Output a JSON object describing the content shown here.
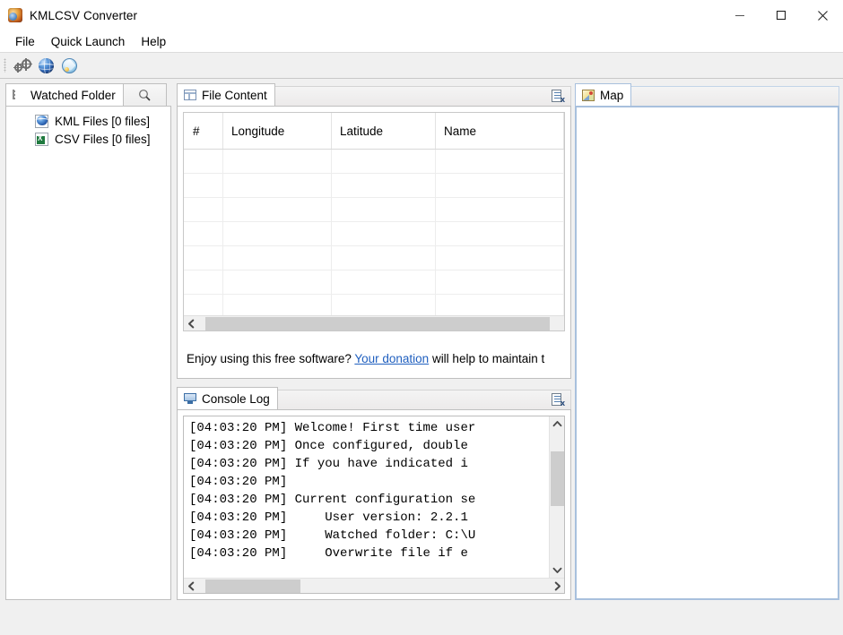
{
  "window": {
    "title": "KMLCSV Converter",
    "app_icon": "app-globe-icon",
    "minimize_label": "─",
    "maximize_label": "□",
    "close_label": "✕"
  },
  "menubar": {
    "items": [
      {
        "label": "File"
      },
      {
        "label": "Quick Launch"
      },
      {
        "label": "Help"
      }
    ]
  },
  "toolbar": {
    "buttons": [
      {
        "name": "settings-gears-button",
        "icon": "gears-icon",
        "tooltip": ""
      },
      {
        "name": "google-earth-button",
        "icon": "blue-globe-icon",
        "tooltip": ""
      },
      {
        "name": "google-maps-button",
        "icon": "light-globe-icon",
        "tooltip": ""
      }
    ]
  },
  "watched_folder": {
    "tab_label": "Watched Folder",
    "tab_icon": "tree-list-icon",
    "search_icon": "search-icon",
    "items": [
      {
        "label": "KML Files [0 files]",
        "icon": "kml-file-icon"
      },
      {
        "label": "CSV Files [0 files]",
        "icon": "csv-file-icon"
      }
    ]
  },
  "file_content": {
    "tab_label": "File Content",
    "tab_icon": "grid-icon",
    "clear_icon": "clear-content-icon",
    "columns": [
      "#",
      "Longitude",
      "Latitude",
      "Name"
    ],
    "rows": [],
    "empty_row_count": 9,
    "hscroll": {
      "left_arrow": "‹",
      "right_arrow": "›",
      "thumb_left_pct": 2,
      "thumb_width_pct": 94
    },
    "donation": {
      "prefix": "Enjoy using this free software? ",
      "link": "Your donation",
      "suffix": " will help to maintain t"
    }
  },
  "console": {
    "tab_label": "Console Log",
    "tab_icon": "monitor-icon",
    "clear_icon": "clear-content-icon",
    "lines": [
      "[04:03:20 PM] Welcome! First time user",
      "[04:03:20 PM] Once configured, double",
      "[04:03:20 PM] If you have indicated i",
      "[04:03:20 PM]",
      "[04:03:20 PM] Current configuration se",
      "[04:03:20 PM]     User version: 2.2.1",
      "[04:03:20 PM]     Watched folder: C:\\U",
      "[04:03:20 PM]     Overwrite file if e"
    ],
    "vscroll": {
      "up_arrow": "˄",
      "down_arrow": "˅",
      "thumb_top_pct": 12,
      "thumb_height_pct": 34
    },
    "hscroll": {
      "left_arrow": "‹",
      "right_arrow": "›",
      "thumb_left_pct": 2,
      "thumb_width_pct": 27
    }
  },
  "map": {
    "tab_label": "Map",
    "tab_icon": "map-thumbnail-icon",
    "content": ""
  },
  "colors": {
    "window_bg": "#f0f0f0",
    "panel_bg": "#ffffff",
    "tab_border": "#bfbfbf",
    "map_border": "#a8c0dd",
    "link": "#1f5fbf",
    "scroll_thumb": "#cdcdcd"
  }
}
